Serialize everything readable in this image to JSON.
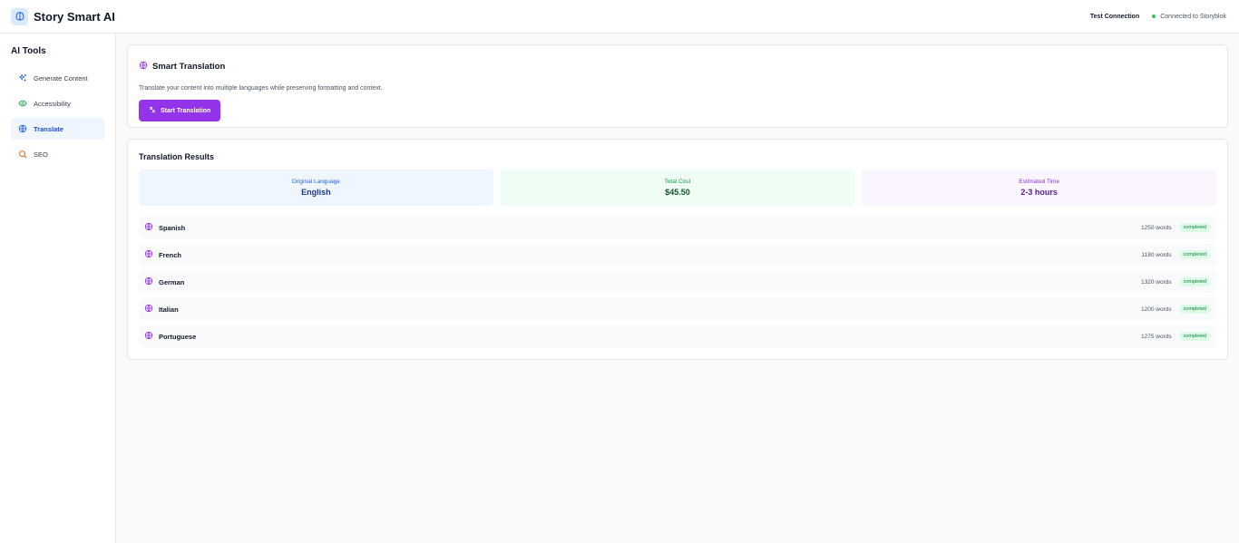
{
  "app": {
    "title": "Story Smart AI"
  },
  "header": {
    "test_connection": "Test Connection",
    "status": "Connected to Storyblok"
  },
  "sidebar": {
    "title": "AI Tools",
    "items": [
      {
        "label": "Generate Content",
        "icon": "sparkles-icon"
      },
      {
        "label": "Accessibility",
        "icon": "eye-icon"
      },
      {
        "label": "Translate",
        "icon": "globe-icon",
        "active": true
      },
      {
        "label": "SEO",
        "icon": "search-icon"
      }
    ]
  },
  "translation": {
    "title": "Smart Translation",
    "description": "Translate your content into multiple languages while preserving formatting and context.",
    "button_label": "Start Translation"
  },
  "results": {
    "title": "Translation Results",
    "stats": [
      {
        "label": "Original Language",
        "value": "English"
      },
      {
        "label": "Total Cost",
        "value": "$45.50"
      },
      {
        "label": "Estimated Time",
        "value": "2-3 hours"
      }
    ],
    "languages": [
      {
        "name": "Spanish",
        "words": "1250 words",
        "status": "completed"
      },
      {
        "name": "French",
        "words": "1180 words",
        "status": "completed"
      },
      {
        "name": "German",
        "words": "1320 words",
        "status": "completed"
      },
      {
        "name": "Italian",
        "words": "1200 words",
        "status": "completed"
      },
      {
        "name": "Portuguese",
        "words": "1275 words",
        "status": "completed"
      }
    ]
  },
  "colors": {
    "accent": "#9333ea",
    "active_nav": "#1d4ed8",
    "success": "#22c55e"
  }
}
